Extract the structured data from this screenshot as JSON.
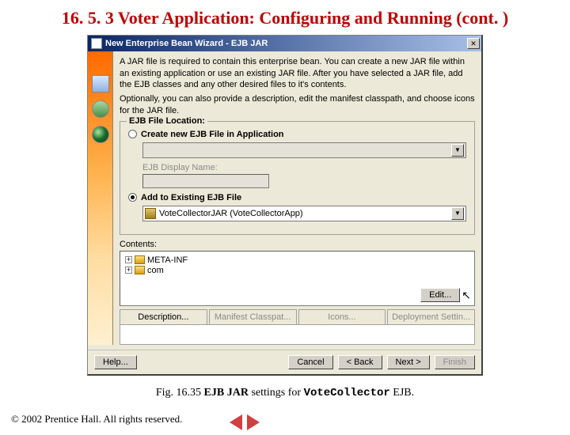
{
  "slide_title": "16. 5. 3   Voter Application: Configuring and Running (cont. )",
  "dialog": {
    "title": "New Enterprise Bean Wizard - EJB JAR",
    "intro_p1": "A JAR file is required to contain this enterprise bean. You can create a new JAR file within an existing application or use an existing JAR file. After you have selected a JAR file, add the EJB classes and any other desired files to it's contents.",
    "intro_p2": "Optionally, you can also provide a description, edit the manifest classpath, and choose icons for the JAR file.",
    "group_legend": "EJB File Location:",
    "radio_create": "Create new EJB File in Application",
    "ejb_display_label": "EJB Display Name:",
    "radio_existing": "Add to Existing EJB File",
    "combo_value": "VoteCollectorJAR (VoteCollectorApp)",
    "contents_label": "Contents:",
    "tree_items": [
      "META-INF",
      "com"
    ],
    "edit_btn": "Edit...",
    "tabs": [
      "Description...",
      "Manifest Classpat...",
      "Icons...",
      "Deployment Settin..."
    ],
    "buttons": {
      "help": "Help...",
      "cancel": "Cancel",
      "back": "< Back",
      "next": "Next >",
      "finish": "Finish"
    }
  },
  "caption": {
    "prefix": "Fig. 16.35 ",
    "bold1": "EJB JAR",
    "mid": " settings for ",
    "mono": "VoteCollector",
    "suffix": " EJB."
  },
  "copyright": "© 2002 Prentice Hall. All rights reserved."
}
